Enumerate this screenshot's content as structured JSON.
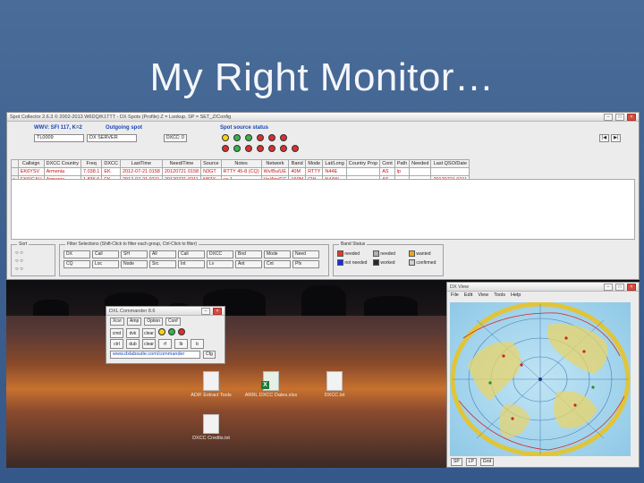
{
  "slide": {
    "title": "My Right Monitor…"
  },
  "main_window": {
    "title": "Spot Collector 2.6.3 © 2002-2013 W6DQ/K1TTT - DX Spots (Profile) Z = Lookup. SP = SET_Z/Config",
    "row1_left_label": "WWV: SFI 117, K=2",
    "row1_mid_label": "Outgoing spot",
    "spot_source_label": "Spot source status",
    "field1": "TL0009",
    "field2": "DX SERVER",
    "mid_text": "DXCC: 0",
    "columns": [
      "Callsign",
      "DXCC Country",
      "Freq",
      "DXCC",
      "LastTime",
      "Need/Time",
      "Source",
      "Notes",
      "Network",
      "Band",
      "Mode",
      "Lat/Long",
      "Country Prop",
      "Cont",
      "Path",
      "Needed",
      "Last QSO/Date"
    ],
    "rows": [
      {
        "marker": "",
        "cells": [
          "EK6YSV",
          "Armenia",
          "7.038.1",
          "EK",
          "2012-07-21 0158",
          "20120721 0158",
          "N3GT",
          "RTTY 45-8 (CQ)",
          "Wv/Bu/UE",
          "40M",
          "RTTY",
          "N44E",
          "",
          "AS",
          "lp",
          "",
          ""
        ]
      },
      {
        "marker": "▸",
        "cells": [
          "EK6IGAU",
          "Armenia",
          "1.836.6",
          "EK",
          "2012-07-21 0211",
          "20120721 0211",
          "N8ZX",
          "us 1",
          "Ve/Ate/CC",
          "160M",
          "CW",
          "N44W",
          "",
          "AS",
          "",
          "",
          "20120721 0211"
        ]
      }
    ],
    "filter_group_label": "Sort",
    "filter_buttons_label": "Filter Selections (Shift-Click to filter each group, Ctrl-Click to filter)",
    "filter_buttons": [
      "DX",
      "Call",
      "SH",
      "All",
      "Call",
      "DXCC",
      "Bnd",
      "Mode",
      "Need",
      "CQ",
      "Loc",
      "Node",
      "Src",
      "Int",
      "Lv",
      "Ant",
      "Cnt",
      "Pfx"
    ],
    "legend_label": "Band Status",
    "legend_items": [
      {
        "label": "needed",
        "color": "#e23a2a"
      },
      {
        "label": "needed",
        "color": "#b0b0b0"
      },
      {
        "label": "not needed",
        "color": "#1e2bd8"
      },
      {
        "label": "wanted",
        "color": "#e8a820"
      },
      {
        "label": "worked",
        "color": "#2a2a2a"
      },
      {
        "label": "confirmed",
        "color": "#d0d0d0"
      }
    ]
  },
  "commander_window": {
    "title": "DXL Commander 8.6",
    "tabs": [
      "Xcvr",
      "Amp",
      "Option",
      "Conf"
    ],
    "buttons_row1": [
      "cmd",
      "dvk",
      "clear"
    ],
    "buttons_row2": [
      "ctrl",
      "dub",
      "clear",
      "rf",
      "lb",
      "b"
    ],
    "status_text": "www.dxlabsuite.com/commander",
    "config_button": "Cfg"
  },
  "desktop_icons": [
    {
      "label": "ADIF Extract Tools",
      "type": "doc"
    },
    {
      "label": "ARRL DXCC Dates.xlsx",
      "type": "xls"
    },
    {
      "label": "DXCC.lst",
      "type": "doc"
    },
    {
      "label": "DXCC Credits.txt",
      "type": "doc"
    }
  ],
  "map_window": {
    "title": "DX View",
    "menu": [
      "File",
      "Edit",
      "View",
      "Tools",
      "Help"
    ],
    "status_items": [
      "SP",
      "LP",
      "Grid"
    ]
  },
  "colors": {
    "background": "#3c5f8f",
    "title_text": "#f4f6fa",
    "spot_text": "#c81010"
  }
}
